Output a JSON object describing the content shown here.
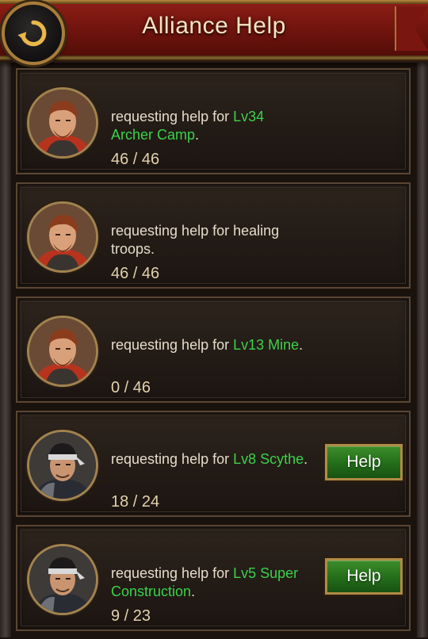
{
  "header": {
    "title": "Alliance Help",
    "back_icon": "back-arrow-icon"
  },
  "colors": {
    "accent_green": "#39d34a",
    "header_red": "#7a1610",
    "gold": "#a87c3a"
  },
  "requests": [
    {
      "text_prefix": "requesting help for ",
      "highlight": "Lv34 Archer Camp",
      "suffix": ".",
      "count": "46 / 46",
      "avatar": "bearded-warrior-icon",
      "help_label": ""
    },
    {
      "text_prefix": "requesting help for healing troops.",
      "highlight": "",
      "suffix": "",
      "count": "46 / 46",
      "avatar": "bearded-warrior-icon",
      "help_label": ""
    },
    {
      "text_prefix": "requesting help for ",
      "highlight": "Lv13 Mine",
      "suffix": ".",
      "count": "0 / 46",
      "avatar": "bearded-warrior-icon",
      "help_label": ""
    },
    {
      "text_prefix": "requesting help for ",
      "highlight": "Lv8 Scythe",
      "suffix": ".",
      "count": "18 / 24",
      "avatar": "headband-soldier-icon",
      "help_label": "Help"
    },
    {
      "text_prefix": "requesting help for ",
      "highlight": "Lv5 Super Construction",
      "suffix": ".",
      "count": "9 / 23",
      "avatar": "headband-soldier-icon",
      "help_label": "Help"
    }
  ]
}
